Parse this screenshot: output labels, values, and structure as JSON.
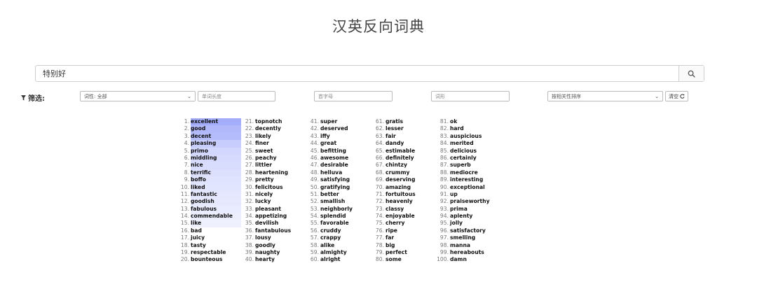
{
  "title": "汉英反向词典",
  "search": {
    "value": "特别好"
  },
  "filters": {
    "label": "筛选:",
    "pos_select": "词性: 全部",
    "length_placeholder": "单词长度",
    "initial_placeholder": "首字母",
    "pattern_placeholder": "词形",
    "sort_select": "按相关性排序",
    "clear_label": "清空"
  },
  "results": [
    {
      "n": "1.",
      "w": "excellent",
      "hl": "#a3adfb"
    },
    {
      "n": "2.",
      "w": "good",
      "hl": "#b1b9fb"
    },
    {
      "n": "3.",
      "w": "decent",
      "hl": "#b5bcfb"
    },
    {
      "n": "4.",
      "w": "pleasing",
      "hl": "#c7cdfc"
    },
    {
      "n": "5.",
      "w": "primo",
      "hl": "#d2d7fd"
    },
    {
      "n": "6.",
      "w": "middling",
      "hl": "#d6dafd"
    },
    {
      "n": "7.",
      "w": "nice",
      "hl": "#d8dcfd"
    },
    {
      "n": "8.",
      "w": "terrific",
      "hl": "#dce0fd"
    },
    {
      "n": "9.",
      "w": "boffo",
      "hl": "#e0e3fe"
    },
    {
      "n": "10.",
      "w": "liked",
      "hl": "#e2e5fe"
    },
    {
      "n": "11.",
      "w": "fantastic",
      "hl": "#e4e7fe"
    },
    {
      "n": "12.",
      "w": "goodish",
      "hl": "#e6e9fe"
    },
    {
      "n": "13.",
      "w": "fabulous",
      "hl": "#e9ebfe"
    },
    {
      "n": "14.",
      "w": "commendable",
      "hl": "#eceefe"
    },
    {
      "n": "15.",
      "w": "like",
      "hl": "#eff0fe"
    },
    {
      "n": "16.",
      "w": "bad",
      "hl": ""
    },
    {
      "n": "17.",
      "w": "juicy",
      "hl": ""
    },
    {
      "n": "18.",
      "w": "tasty",
      "hl": ""
    },
    {
      "n": "19.",
      "w": "respectable",
      "hl": ""
    },
    {
      "n": "20.",
      "w": "bounteous",
      "hl": ""
    },
    {
      "n": "21.",
      "w": "topnotch",
      "hl": ""
    },
    {
      "n": "22.",
      "w": "decently",
      "hl": ""
    },
    {
      "n": "23.",
      "w": "likely",
      "hl": ""
    },
    {
      "n": "24.",
      "w": "finer",
      "hl": ""
    },
    {
      "n": "25.",
      "w": "sweet",
      "hl": ""
    },
    {
      "n": "26.",
      "w": "peachy",
      "hl": ""
    },
    {
      "n": "27.",
      "w": "littler",
      "hl": ""
    },
    {
      "n": "28.",
      "w": "heartening",
      "hl": ""
    },
    {
      "n": "29.",
      "w": "pretty",
      "hl": ""
    },
    {
      "n": "30.",
      "w": "felicitous",
      "hl": ""
    },
    {
      "n": "31.",
      "w": "nicely",
      "hl": ""
    },
    {
      "n": "32.",
      "w": "lucky",
      "hl": ""
    },
    {
      "n": "33.",
      "w": "pleasant",
      "hl": ""
    },
    {
      "n": "34.",
      "w": "appetizing",
      "hl": ""
    },
    {
      "n": "35.",
      "w": "devilish",
      "hl": ""
    },
    {
      "n": "36.",
      "w": "fantabulous",
      "hl": ""
    },
    {
      "n": "37.",
      "w": "lousy",
      "hl": ""
    },
    {
      "n": "38.",
      "w": "goodly",
      "hl": ""
    },
    {
      "n": "39.",
      "w": "naughty",
      "hl": ""
    },
    {
      "n": "40.",
      "w": "hearty",
      "hl": ""
    },
    {
      "n": "41.",
      "w": "super",
      "hl": ""
    },
    {
      "n": "42.",
      "w": "deserved",
      "hl": ""
    },
    {
      "n": "43.",
      "w": "iffy",
      "hl": ""
    },
    {
      "n": "44.",
      "w": "great",
      "hl": ""
    },
    {
      "n": "45.",
      "w": "befitting",
      "hl": ""
    },
    {
      "n": "46.",
      "w": "awesome",
      "hl": ""
    },
    {
      "n": "47.",
      "w": "desirable",
      "hl": ""
    },
    {
      "n": "48.",
      "w": "helluva",
      "hl": ""
    },
    {
      "n": "49.",
      "w": "satisfying",
      "hl": ""
    },
    {
      "n": "50.",
      "w": "gratifying",
      "hl": ""
    },
    {
      "n": "51.",
      "w": "better",
      "hl": ""
    },
    {
      "n": "52.",
      "w": "smallish",
      "hl": ""
    },
    {
      "n": "53.",
      "w": "neighborly",
      "hl": ""
    },
    {
      "n": "54.",
      "w": "splendid",
      "hl": ""
    },
    {
      "n": "55.",
      "w": "favorable",
      "hl": ""
    },
    {
      "n": "56.",
      "w": "cruddy",
      "hl": ""
    },
    {
      "n": "57.",
      "w": "crappy",
      "hl": ""
    },
    {
      "n": "58.",
      "w": "alike",
      "hl": ""
    },
    {
      "n": "59.",
      "w": "almighty",
      "hl": ""
    },
    {
      "n": "60.",
      "w": "alright",
      "hl": ""
    },
    {
      "n": "61.",
      "w": "gratis",
      "hl": ""
    },
    {
      "n": "62.",
      "w": "lesser",
      "hl": ""
    },
    {
      "n": "63.",
      "w": "fair",
      "hl": ""
    },
    {
      "n": "64.",
      "w": "dandy",
      "hl": ""
    },
    {
      "n": "65.",
      "w": "estimable",
      "hl": ""
    },
    {
      "n": "66.",
      "w": "definitely",
      "hl": ""
    },
    {
      "n": "67.",
      "w": "chintzy",
      "hl": ""
    },
    {
      "n": "68.",
      "w": "crummy",
      "hl": ""
    },
    {
      "n": "69.",
      "w": "deserving",
      "hl": ""
    },
    {
      "n": "70.",
      "w": "amazing",
      "hl": ""
    },
    {
      "n": "71.",
      "w": "fortuitous",
      "hl": ""
    },
    {
      "n": "72.",
      "w": "heavenly",
      "hl": ""
    },
    {
      "n": "73.",
      "w": "classy",
      "hl": ""
    },
    {
      "n": "74.",
      "w": "enjoyable",
      "hl": ""
    },
    {
      "n": "75.",
      "w": "cherry",
      "hl": ""
    },
    {
      "n": "76.",
      "w": "ripe",
      "hl": ""
    },
    {
      "n": "77.",
      "w": "far",
      "hl": ""
    },
    {
      "n": "78.",
      "w": "big",
      "hl": ""
    },
    {
      "n": "79.",
      "w": "perfect",
      "hl": ""
    },
    {
      "n": "80.",
      "w": "some",
      "hl": ""
    },
    {
      "n": "81.",
      "w": "ok",
      "hl": ""
    },
    {
      "n": "82.",
      "w": "hard",
      "hl": ""
    },
    {
      "n": "83.",
      "w": "auspicious",
      "hl": ""
    },
    {
      "n": "84.",
      "w": "merited",
      "hl": ""
    },
    {
      "n": "85.",
      "w": "delicious",
      "hl": ""
    },
    {
      "n": "86.",
      "w": "certainly",
      "hl": ""
    },
    {
      "n": "87.",
      "w": "superb",
      "hl": ""
    },
    {
      "n": "88.",
      "w": "mediocre",
      "hl": ""
    },
    {
      "n": "89.",
      "w": "interesting",
      "hl": ""
    },
    {
      "n": "90.",
      "w": "exceptional",
      "hl": ""
    },
    {
      "n": "91.",
      "w": "up",
      "hl": ""
    },
    {
      "n": "92.",
      "w": "praiseworthy",
      "hl": ""
    },
    {
      "n": "93.",
      "w": "prima",
      "hl": ""
    },
    {
      "n": "94.",
      "w": "aplenty",
      "hl": ""
    },
    {
      "n": "95.",
      "w": "jolly",
      "hl": ""
    },
    {
      "n": "96.",
      "w": "satisfactory",
      "hl": ""
    },
    {
      "n": "97.",
      "w": "smelling",
      "hl": ""
    },
    {
      "n": "98.",
      "w": "manna",
      "hl": ""
    },
    {
      "n": "99.",
      "w": "hereabouts",
      "hl": ""
    },
    {
      "n": "100.",
      "w": "damn",
      "hl": ""
    }
  ]
}
